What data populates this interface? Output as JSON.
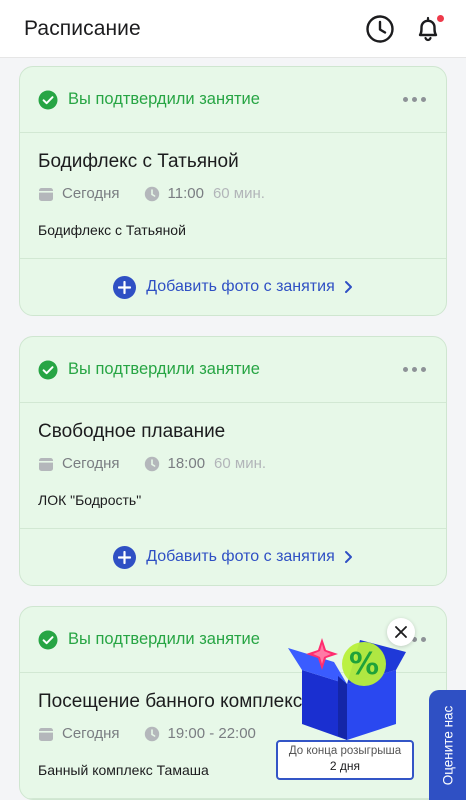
{
  "header": {
    "title": "Расписание",
    "history_icon": "clock-icon",
    "notifications_icon": "bell-icon",
    "notification_badge_color": "#ee3a4a"
  },
  "cards": [
    {
      "status": "Вы подтвердили занятие",
      "title": "Бодифлекс с Татьяной",
      "day": "Сегодня",
      "time": "11:00",
      "duration": "60 мин.",
      "location": "Бодифлекс с Татьяной",
      "add_photo": "Добавить фото с занятия"
    },
    {
      "status": "Вы подтвердили занятие",
      "title": "Свободное плавание",
      "day": "Сегодня",
      "time": "18:00",
      "duration": "60 мин.",
      "location": "ЛОК \"Бодрость\"",
      "add_photo": "Добавить фото с занятия"
    },
    {
      "status": "Вы подтвердили занятие",
      "title": "Посещение банного комплекса",
      "day": "Сегодня",
      "time": "19:00 - 22:00",
      "duration": "",
      "location": "Банный комплекс Тамаша",
      "add_photo": ""
    }
  ],
  "promo": {
    "line1": "До конца розыгрыша",
    "line2": "2 дня",
    "icon": "gift-box-percent-icon"
  },
  "rate_tab": {
    "label": "Оцените нас"
  },
  "colors": {
    "accent": "#2f50c4",
    "success": "#27a544",
    "card_bg": "#e7f8e8"
  }
}
